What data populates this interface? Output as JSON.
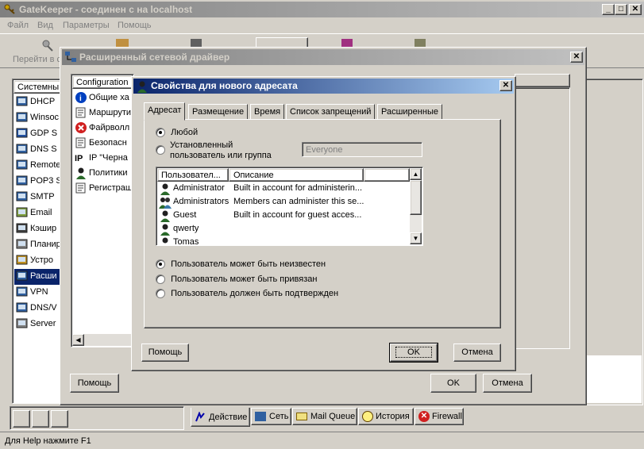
{
  "main": {
    "title": "GateKeeper - соединен с на localhost",
    "menu": [
      "Файл",
      "Вид",
      "Параметры",
      "Помощь"
    ],
    "toolbar_first": "Перейти в с",
    "status": "Для Help нажмите F1",
    "sidebar_header": "Системны",
    "sidebar_items": [
      "DHCP",
      "Winsoc",
      "GDP S",
      "DNS S",
      "Remote",
      "POP3 S",
      "SMTP",
      "Email",
      "Кэшир",
      "Планир",
      "Устро",
      "Расши",
      "VPN",
      "DNS/V",
      "Server"
    ],
    "bottom_tabs": [
      "Действие",
      "Сеть",
      "Mail Queue",
      "История",
      "Firewall"
    ]
  },
  "driver": {
    "title": "Расширенный сетевой драйвер",
    "tree_header": "Configuration",
    "tree_items": [
      "Общие ха",
      "Маршрути",
      "Файрволл",
      "Безопасн",
      "IP \"Черна",
      "Политики",
      "Регистраш"
    ],
    "help": "Помощь",
    "ok": "OK",
    "cancel": "Отмена"
  },
  "props": {
    "title": "Свойства для нового адресата",
    "tabs": [
      "Адресат",
      "Размещение",
      "Время",
      "Список запрещений",
      "Расширенные"
    ],
    "radio_any": "Любой",
    "radio_set": "Установленный пользователь или группа",
    "everyone_value": "Everyone",
    "col_user": "Пользовател...",
    "col_desc": "Описание",
    "rows": [
      {
        "name": "Administrator",
        "desc": "Built in account for administerin..."
      },
      {
        "name": "Administrators",
        "desc": "Members can administer this se..."
      },
      {
        "name": "Guest",
        "desc": "Built in account for guest acces..."
      },
      {
        "name": "qwerty",
        "desc": ""
      },
      {
        "name": "Tomas",
        "desc": ""
      }
    ],
    "opt1": "Пользователь может быть неизвестен",
    "opt2": "Пользователь может быть привязан",
    "opt3": "Пользователь должен быть подтвержден",
    "help": "Помощь",
    "ok": "OK",
    "cancel": "Отмена"
  }
}
